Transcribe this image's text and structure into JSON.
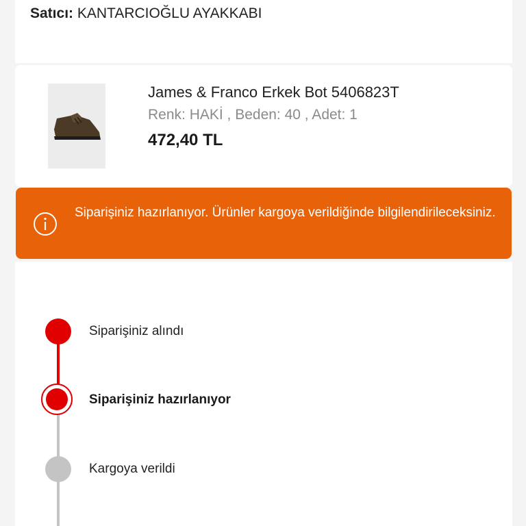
{
  "seller": {
    "label": "Satıcı:",
    "name": "KANTARCIOĞLU AYAKKABI"
  },
  "product": {
    "name": "James & Franco Erkek Bot 5406823T",
    "attributes": "Renk: HAKİ , Beden: 40 , Adet: 1",
    "price": "472,40 TL",
    "image_icon": "boot-icon"
  },
  "status_banner": {
    "icon": "info-icon",
    "message": "Siparişiniz hazırlanıyor. Ürünler kargoya verildiğinde bilgilendirileceksiniz.",
    "color": "#e8620a"
  },
  "timeline": {
    "steps": [
      {
        "label": "Siparişiniz alındı",
        "state": "done"
      },
      {
        "label": "Siparişiniz hazırlanıyor",
        "state": "active"
      },
      {
        "label": "Kargoya verildi",
        "state": "pending"
      }
    ],
    "colors": {
      "done": "#e00000",
      "pending": "#c4c4c4"
    }
  }
}
